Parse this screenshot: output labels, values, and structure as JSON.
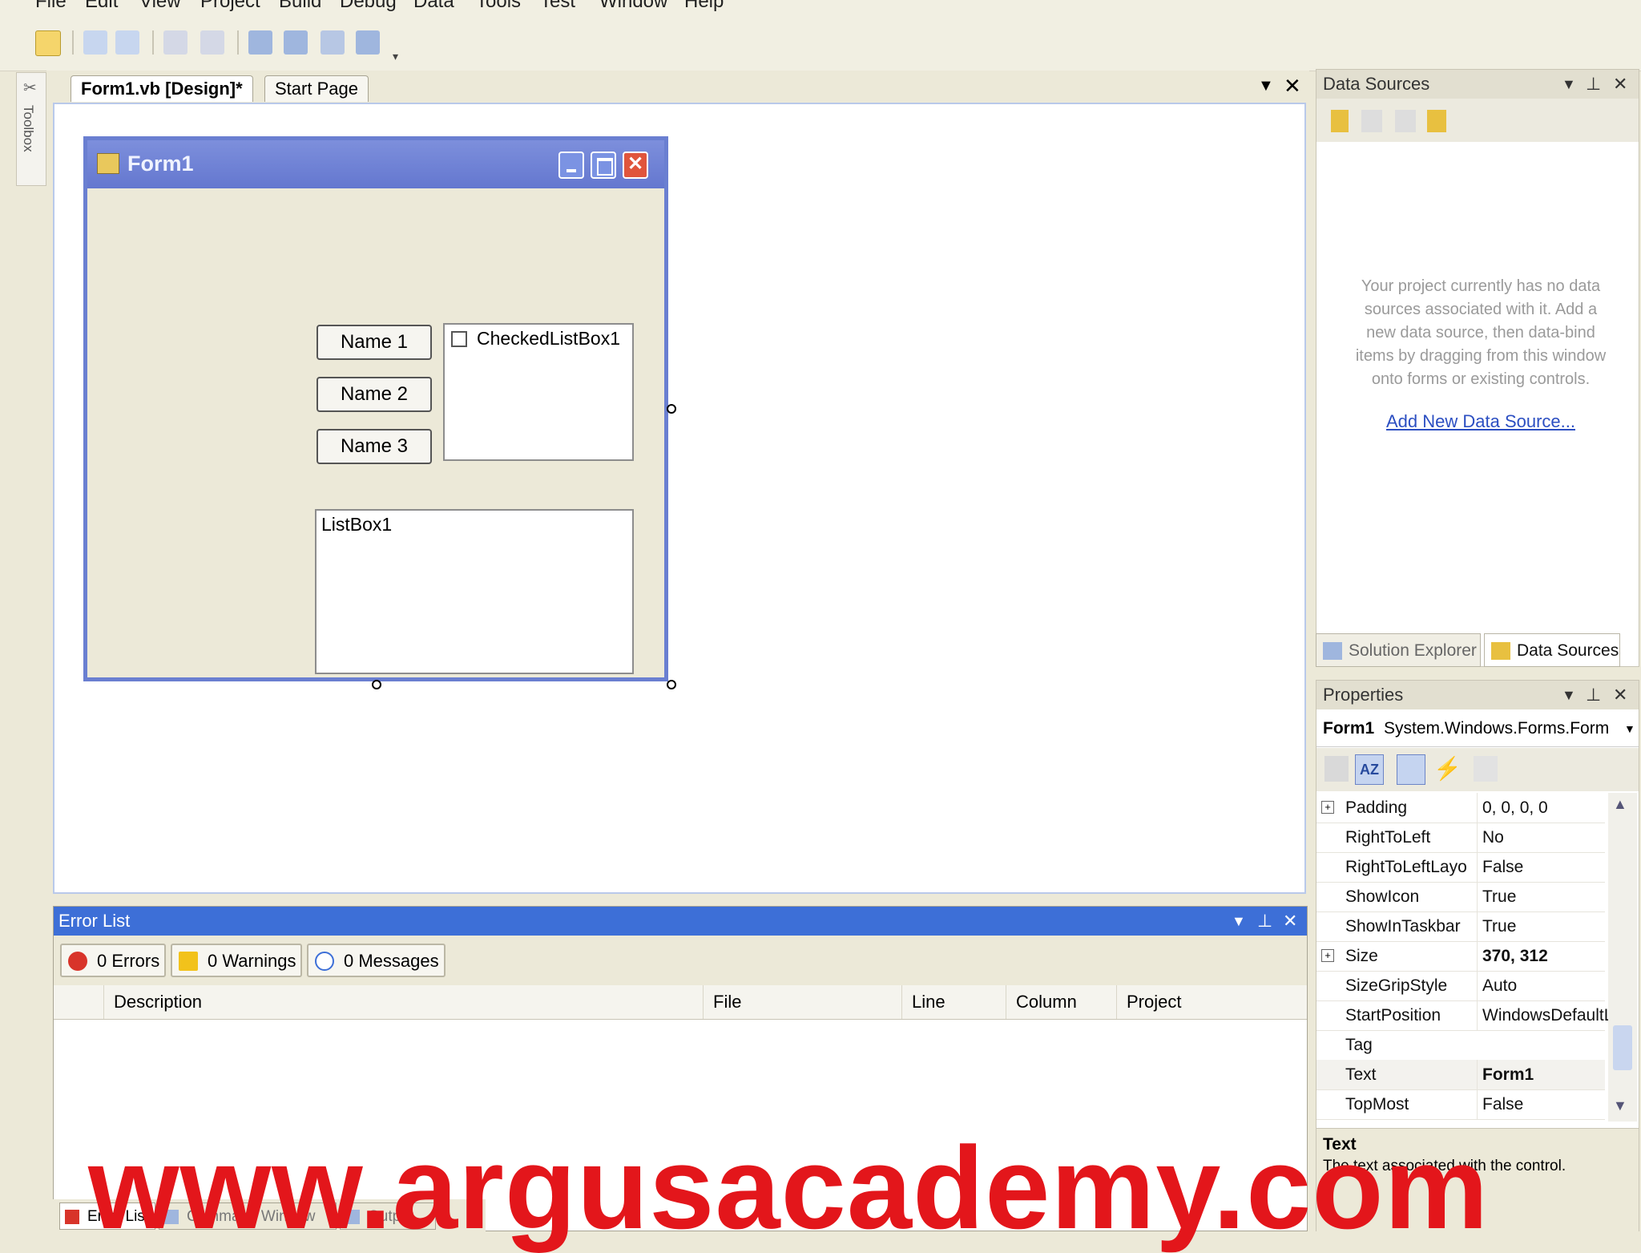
{
  "menu": [
    "File",
    "Edit",
    "View",
    "Project",
    "Build",
    "Debug",
    "Data",
    "Tools",
    "Test",
    "Window",
    "Help"
  ],
  "toolbox": {
    "label": "Toolbox"
  },
  "tabs": [
    {
      "label": "Form1.vb [Design]*",
      "active": true
    },
    {
      "label": "Start Page",
      "active": false
    }
  ],
  "form": {
    "title": "Form1",
    "buttons": [
      "Name 1",
      "Name 2",
      "Name 3"
    ],
    "checked_list": "CheckedListBox1",
    "list_box": "ListBox1"
  },
  "data_sources": {
    "title": "Data Sources",
    "empty_lines": [
      "Your project currently has no data",
      "sources associated with it. Add a",
      "new data source, then data-bind",
      "items by dragging from this window",
      "onto forms or existing controls."
    ],
    "link": "Add New Data Source...",
    "tabs": [
      "Solution Explorer",
      "Data Sources"
    ]
  },
  "properties": {
    "title": "Properties",
    "object": "Form1",
    "object_type": "System.Windows.Forms.Form",
    "rows": [
      {
        "name": "Padding",
        "value": "0, 0, 0, 0",
        "expand": "+"
      },
      {
        "name": "RightToLeft",
        "value": "No"
      },
      {
        "name": "RightToLeftLayo",
        "value": "False"
      },
      {
        "name": "ShowIcon",
        "value": "True"
      },
      {
        "name": "ShowInTaskbar",
        "value": "True"
      },
      {
        "name": "Size",
        "value": "370, 312",
        "expand": "+"
      },
      {
        "name": "SizeGripStyle",
        "value": "Auto"
      },
      {
        "name": "StartPosition",
        "value": "WindowsDefaultL"
      },
      {
        "name": "Tag",
        "value": ""
      },
      {
        "name": "Text",
        "value": "Form1"
      },
      {
        "name": "TopMost",
        "value": "False"
      }
    ],
    "desc_title": "Text",
    "desc_text": "The text associated with the control."
  },
  "error_list": {
    "title": "Error List",
    "errors": "0 Errors",
    "warnings": "0 Warnings",
    "messages": "0 Messages",
    "columns": [
      "Description",
      "File",
      "Line",
      "Column",
      "Project"
    ]
  },
  "bottom_tabs": [
    "Error List",
    "Command Window",
    "Output"
  ],
  "watermark": "www.argusacademy.com",
  "colors": {
    "form_border": "#6a7fd1",
    "error_header": "#3d6fd7",
    "watermark": "#e3161b",
    "link": "#2c4fc2"
  }
}
